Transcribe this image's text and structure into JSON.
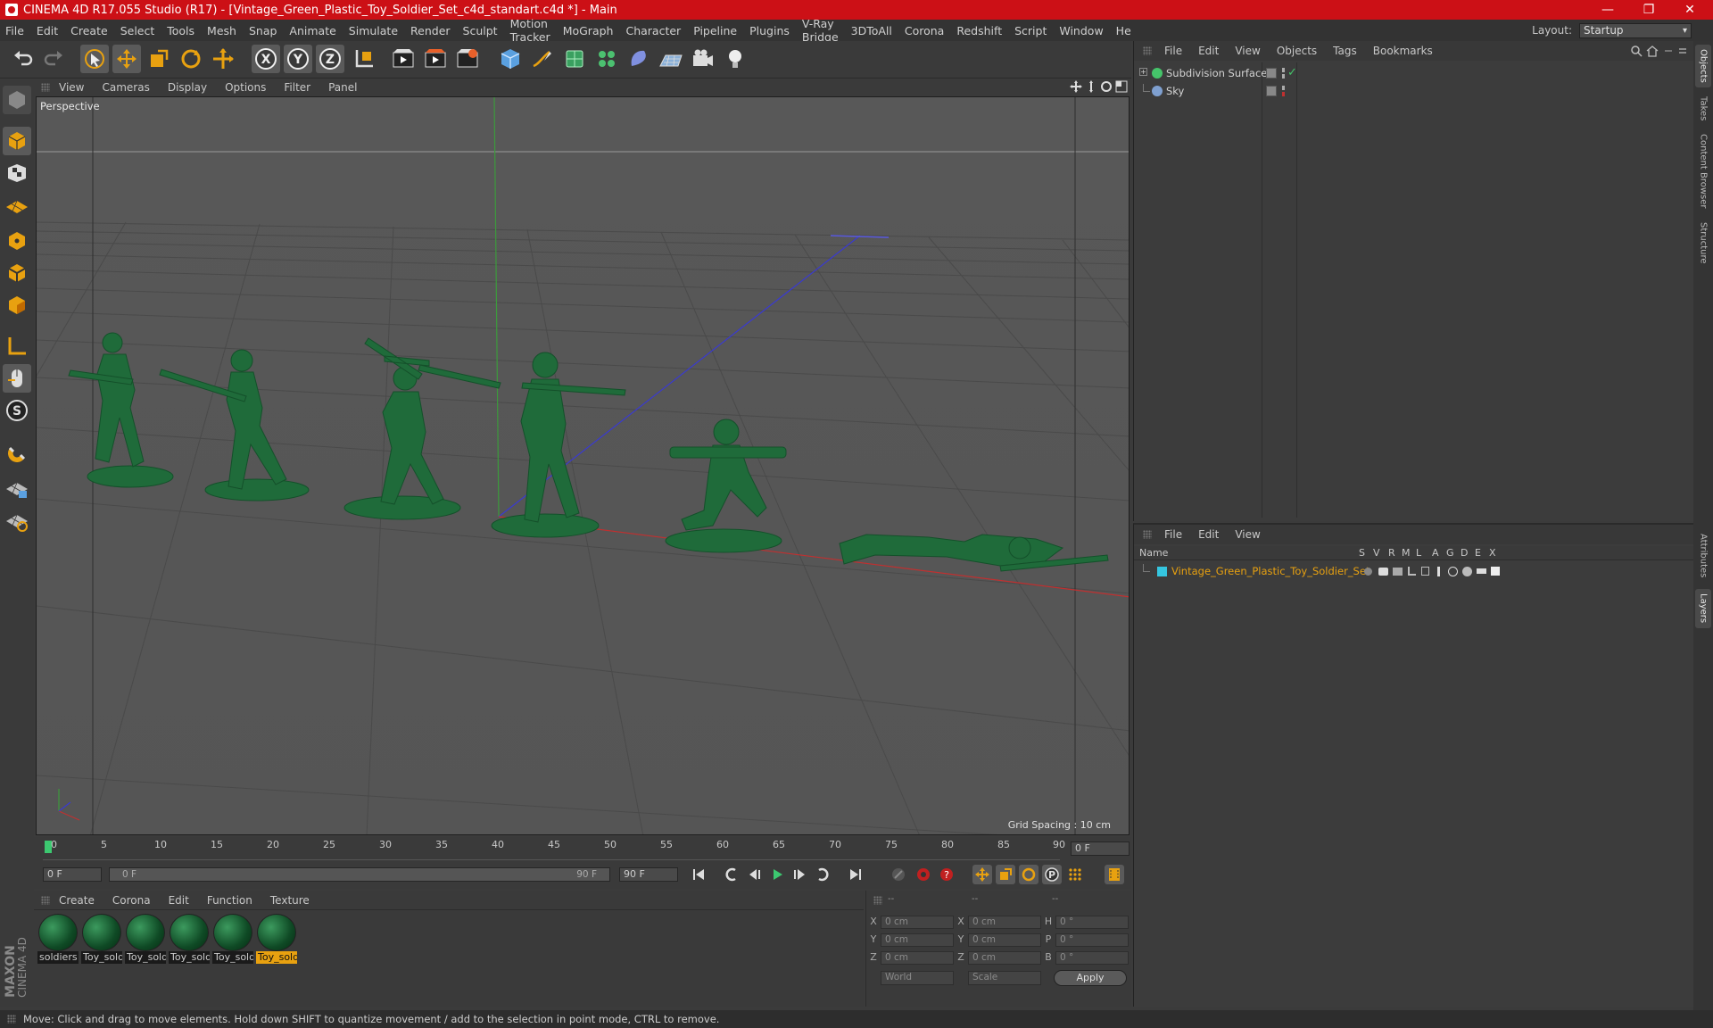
{
  "title": "CINEMA 4D R17.055 Studio (R17) - [Vintage_Green_Plastic_Toy_Soldier_Set_c4d_standart.c4d *] - Main",
  "window_controls": {
    "minimize": "—",
    "maximize": "❐",
    "close": "✕"
  },
  "menu": [
    "File",
    "Edit",
    "Create",
    "Select",
    "Tools",
    "Mesh",
    "Snap",
    "Animate",
    "Simulate",
    "Render",
    "Sculpt",
    "Motion Tracker",
    "MoGraph",
    "Character",
    "Pipeline",
    "Plugins",
    "V-Ray Bridge",
    "3DToAll",
    "Corona",
    "Redshift",
    "Script",
    "Window",
    "Help"
  ],
  "layout": {
    "label": "Layout:",
    "value": "Startup"
  },
  "viewport": {
    "menu": [
      "View",
      "Cameras",
      "Display",
      "Options",
      "Filter",
      "Panel"
    ],
    "label": "Perspective",
    "grid_spacing": "Grid Spacing : 10 cm"
  },
  "timeline": {
    "ticks": [
      "0",
      "5",
      "10",
      "15",
      "20",
      "25",
      "30",
      "35",
      "40",
      "45",
      "50",
      "55",
      "60",
      "65",
      "70",
      "75",
      "80",
      "85",
      "90"
    ],
    "current_frame": "0 F",
    "start_field": "0 F",
    "range_start": "0 F",
    "range_end": "90 F",
    "end_field": "90 F"
  },
  "material_panel": {
    "menu": [
      "Create",
      "Corona",
      "Edit",
      "Function",
      "Texture"
    ],
    "materials": [
      {
        "label": "soldiers",
        "selected": false
      },
      {
        "label": "Toy_sold",
        "selected": false
      },
      {
        "label": "Toy_sold",
        "selected": false
      },
      {
        "label": "Toy_sold",
        "selected": false
      },
      {
        "label": "Toy_sold",
        "selected": false
      },
      {
        "label": "Toy_sold",
        "selected": true
      }
    ]
  },
  "coordinates": {
    "headers": [
      "--",
      "--",
      "--"
    ],
    "rows": [
      {
        "l1": "X",
        "v1": "0 cm",
        "l2": "X",
        "v2": "0 cm",
        "l3": "H",
        "v3": "0 °"
      },
      {
        "l1": "Y",
        "v1": "0 cm",
        "l2": "Y",
        "v2": "0 cm",
        "l3": "P",
        "v3": "0 °"
      },
      {
        "l1": "Z",
        "v1": "0 cm",
        "l2": "Z",
        "v2": "0 cm",
        "l3": "B",
        "v3": "0 °"
      }
    ],
    "mode1": "World",
    "mode2": "Scale",
    "apply": "Apply"
  },
  "objects_panel": {
    "menu": [
      "File",
      "Edit",
      "View",
      "Objects",
      "Tags",
      "Bookmarks"
    ],
    "items": [
      {
        "name": "Subdivision Surface",
        "color": "#45c46a"
      },
      {
        "name": "Sky",
        "color": "#7fa0d0"
      }
    ]
  },
  "layers_panel": {
    "menu": [
      "File",
      "Edit",
      "View"
    ],
    "columns": [
      "Name",
      "S",
      "V",
      "R",
      "M",
      "L",
      "A",
      "G",
      "D",
      "E",
      "X"
    ],
    "layer": {
      "name": "Vintage_Green_Plastic_Toy_Soldier_Set",
      "color": "#35c6e0"
    }
  },
  "right_tabs": [
    "Objects",
    "Takes",
    "Content Browser",
    "Structure",
    "Attributes",
    "Layers"
  ],
  "branding": {
    "line1": "MAXON",
    "line2": "CINEMA 4D"
  },
  "status": "Move: Click and drag to move elements. Hold down SHIFT to quantize movement / add to the selection in point mode, CTRL to remove.",
  "colors": {
    "accent": "#e8a110",
    "titlebar": "#cc1016",
    "soldier": "#1f6b3a"
  }
}
